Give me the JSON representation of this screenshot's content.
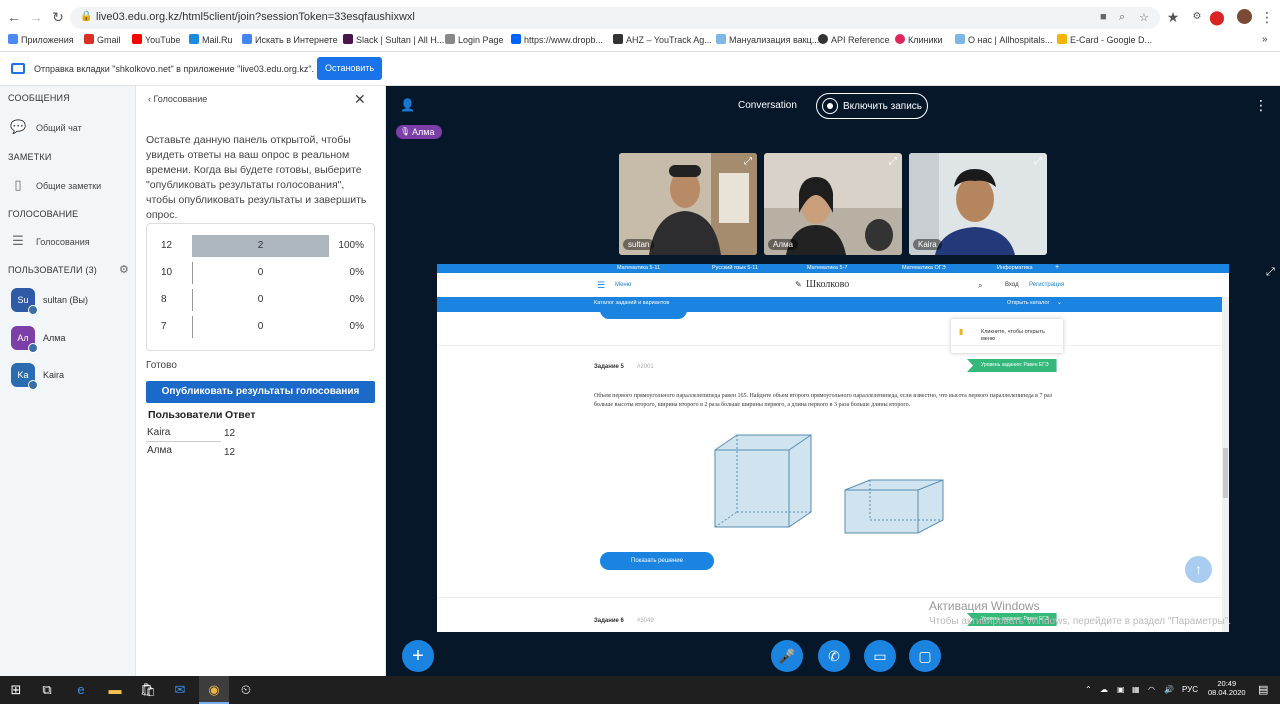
{
  "browser": {
    "url": "live03.edu.org.kz/html5client/join?sessionToken=33esqfaushixwxl",
    "bookmarks": [
      "Приложения",
      "Gmail",
      "YouTube",
      "Mail.Ru",
      "Искать в Интернете",
      "Slack | Sultan | All H...",
      "Login Page",
      "https://www.dropb...",
      "AHZ – YouTrack Ag...",
      "Мануализация вакц...",
      "API Reference",
      "Клиники",
      "О нас | Allhospitals...",
      "E-Card - Google D..."
    ]
  },
  "share_banner": {
    "text": "Отправка вкладки \"shkolkovo.net\" в приложение \"live03.edu.org.kz\".",
    "stop_label": "Остановить"
  },
  "sidebar": {
    "messages_header": "СООБЩЕНИЯ",
    "public_chat": "Общий чат",
    "notes_header": "ЗАМЕТКИ",
    "shared_notes": "Общие заметки",
    "polling_header": "ГОЛОСОВАНИЕ",
    "polling_item": "Голосования",
    "users_header": "ПОЛЬЗОВАТЕЛИ (3)",
    "users": [
      {
        "initials": "Su",
        "name": "sultan (Вы)",
        "color": "#2e5aa6"
      },
      {
        "initials": "Ал",
        "name": "Алма",
        "color": "#7b3fa7"
      },
      {
        "initials": "Ka",
        "name": "Kaira",
        "color": "#2b6cb0"
      }
    ]
  },
  "poll": {
    "header": "Голосование",
    "description": "Оставьте данную панель открытой, чтобы увидеть ответы на ваш опрос в реальном времени. Когда вы будете готовы, выберите \"опубликовать результаты голосования\", чтобы опубликовать результаты и завершить опрос.",
    "results": [
      {
        "label": "12",
        "count": "2",
        "percent": "100%",
        "fraction": 1.0
      },
      {
        "label": "10",
        "count": "0",
        "percent": "0%",
        "fraction": 0
      },
      {
        "label": "8",
        "count": "0",
        "percent": "0%",
        "fraction": 0
      },
      {
        "label": "7",
        "count": "0",
        "percent": "0%",
        "fraction": 0
      }
    ],
    "ready": "Готово",
    "publish_label": "Опубликовать результаты голосования",
    "table_headers": [
      "Пользователи",
      "Ответ"
    ],
    "responses": [
      {
        "user": "Kaira",
        "answer": "12"
      },
      {
        "user": "Алма",
        "answer": "12"
      }
    ]
  },
  "meeting": {
    "title": "Conversation",
    "record_label": "Включить запись",
    "talking": "Алма",
    "cams": [
      {
        "name": "sultan",
        "bg": "#8c7b6a"
      },
      {
        "name": "Алма",
        "bg": "#c9c2b8"
      },
      {
        "name": "Kaira",
        "bg": "#cfd7dc"
      }
    ]
  },
  "shared_site": {
    "tabs": [
      "Математика 5-11",
      "Русский язык 5-11",
      "Математика 5-7",
      "Математика ОГЭ",
      "Информатика",
      "+"
    ],
    "menu": "Меню",
    "logo": "Школково",
    "login": "Вход",
    "register": "Регистрация",
    "catalog": "Каталог заданий и вариантов",
    "open_catalog": "Открыть каталог",
    "tip": "Кликните, чтобы открыть меню",
    "task5_label": "Задание 5",
    "task5_num": "#2001",
    "task_text": "Объем первого прямоугольного параллелепипеда равен 165. Найдите объем второго прямоугольного параллелепипеда, если известно, что высота первого параллелепипеда в 7 раз больше высоты второго, ширина второго в 2 раза больше ширины первого, а длина первого в 3 раза больше длины второго.",
    "level_badge": "Уровень задания: Равен ЕГЭ",
    "show_solution": "Показать решение",
    "task6_label": "Задание 6",
    "task6_num": "#3049"
  },
  "windows_activation": {
    "title": "Активация Windows",
    "text": "Чтобы активировать Windows, перейдите в раздел \"Параметры\"."
  },
  "taskbar": {
    "lang": "РУС",
    "time": "20:49",
    "date": "08.04.2020"
  }
}
